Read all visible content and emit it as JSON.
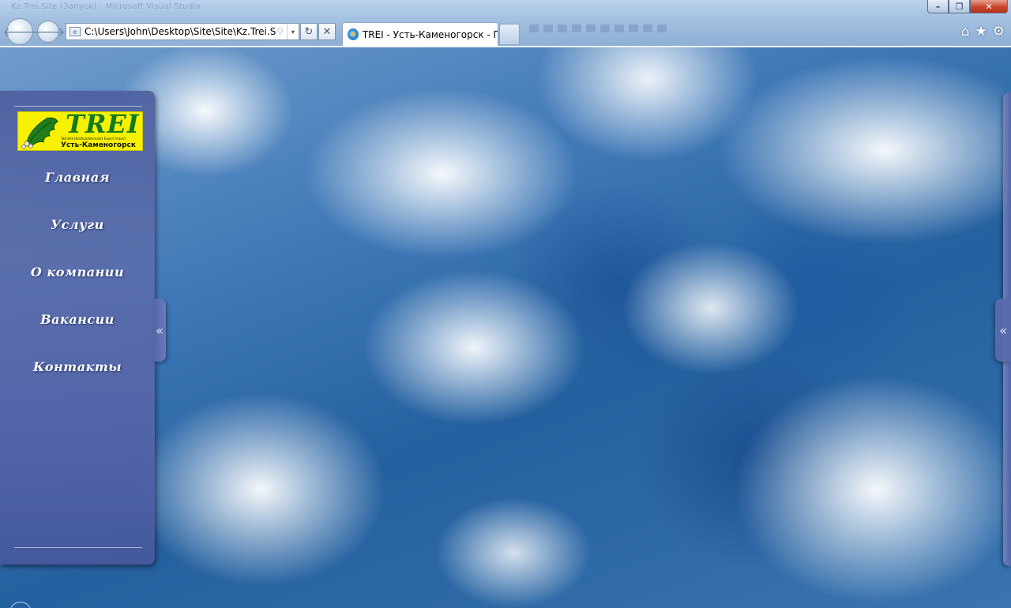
{
  "window": {
    "title_ghost": "Kz.Trei.Site (Запуск) - Microsoft Visual Studio",
    "minimize": "–",
    "maximize": "❐",
    "close": "✕"
  },
  "address_bar": {
    "url": "C:\\Users\\John\\Desktop\\Site\\Site\\Kz.Trei.Site",
    "search_icon": "search-icon",
    "dropdown_icon": "▾"
  },
  "buttons": {
    "back": "🡐",
    "forward": "🡒",
    "refresh": "↻",
    "stop": "✕"
  },
  "tab": {
    "title": "TREI - Усть-Каменогорск - Г..."
  },
  "right_icons": {
    "home": "⌂",
    "favorites": "★",
    "tools": "⚙"
  },
  "logo": {
    "brand": "TREI",
    "tagline": "Twinlink Holzhandelsmarkt Export Import",
    "city": "Усть-Каменогорск"
  },
  "menu": {
    "items": [
      {
        "label": "Главная"
      },
      {
        "label": "Услуги"
      },
      {
        "label": "О компании"
      },
      {
        "label": "Вакансии"
      },
      {
        "label": "Контакты"
      }
    ]
  },
  "panel_toggle": {
    "left": "«",
    "right": "«"
  },
  "colors": {
    "sidebar": "#5a6aac",
    "logo_bg": "#f6f100",
    "logo_text": "#0f7a20"
  }
}
